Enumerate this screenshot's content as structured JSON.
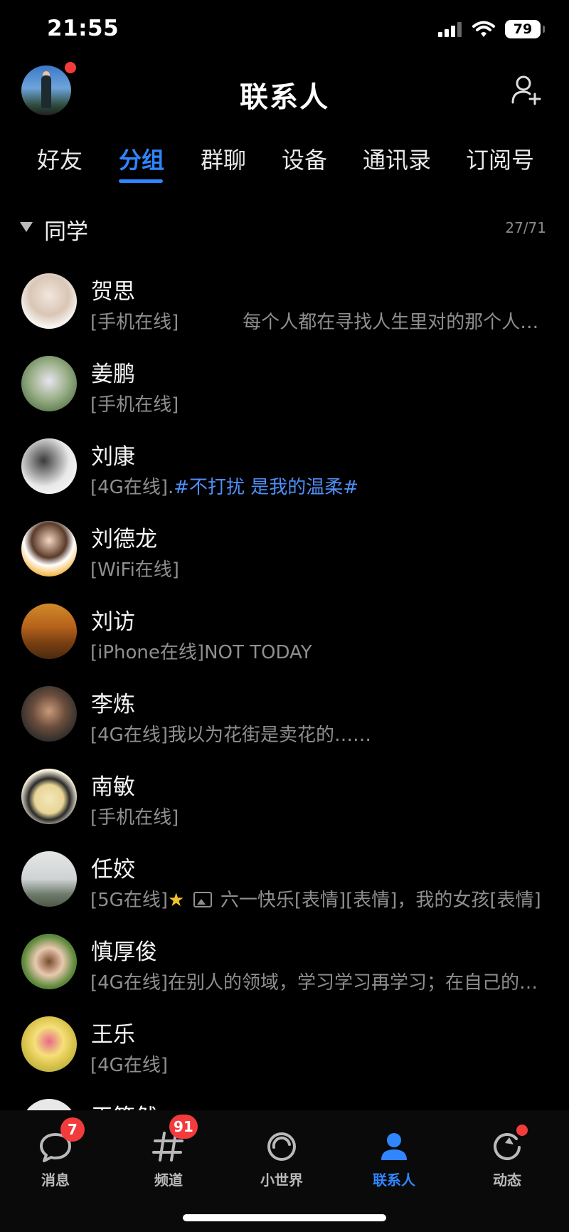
{
  "status": {
    "time": "21:55",
    "battery": "79"
  },
  "header": {
    "title": "联系人"
  },
  "tabs": [
    "好友",
    "分组",
    "群聊",
    "设备",
    "通讯录",
    "订阅号"
  ],
  "group": {
    "name": "同学",
    "count": "27/71"
  },
  "contacts": [
    {
      "name": "贺思",
      "status": "[手机在线]",
      "signature": "每个人都在寻找人生里对的那个人…"
    },
    {
      "name": "姜鹏",
      "status": "[手机在线]",
      "signature": ""
    },
    {
      "name": "刘康",
      "status": "[4G在线].",
      "signature": "#不打扰 是我的温柔#"
    },
    {
      "name": "刘德龙",
      "status": "[WiFi在线]",
      "signature": ""
    },
    {
      "name": "刘访",
      "status": "[iPhone在线]",
      "signature": "NOT TODAY"
    },
    {
      "name": "李炼",
      "status": "[4G在线]",
      "signature": "我以为花街是卖花的……"
    },
    {
      "name": "南敏",
      "status": "[手机在线]",
      "signature": ""
    },
    {
      "name": "任姣",
      "status": "[5G在线]",
      "signature": "六一快乐[表情][表情]，我的女孩[表情]"
    },
    {
      "name": "慎厚俊",
      "status": "[4G在线]",
      "signature": "在别人的领域，学习学习再学习；在自己的…"
    },
    {
      "name": "王乐",
      "status": "[4G在线]",
      "signature": ""
    },
    {
      "name": "王筱然",
      "status": "",
      "signature": ""
    }
  ],
  "tabbar": [
    {
      "label": "消息",
      "badge": "7",
      "icon": "message-icon"
    },
    {
      "label": "频道",
      "badge": "91",
      "icon": "channel-icon"
    },
    {
      "label": "小世界",
      "badge": "",
      "icon": "world-icon"
    },
    {
      "label": "联系人",
      "badge": "",
      "icon": "contacts-icon"
    },
    {
      "label": "动态",
      "badge": "",
      "icon": "moments-icon"
    }
  ],
  "colors": {
    "accent": "#2f86ff",
    "badge": "#f23c3c",
    "signature_link": "#4f8ef5"
  }
}
